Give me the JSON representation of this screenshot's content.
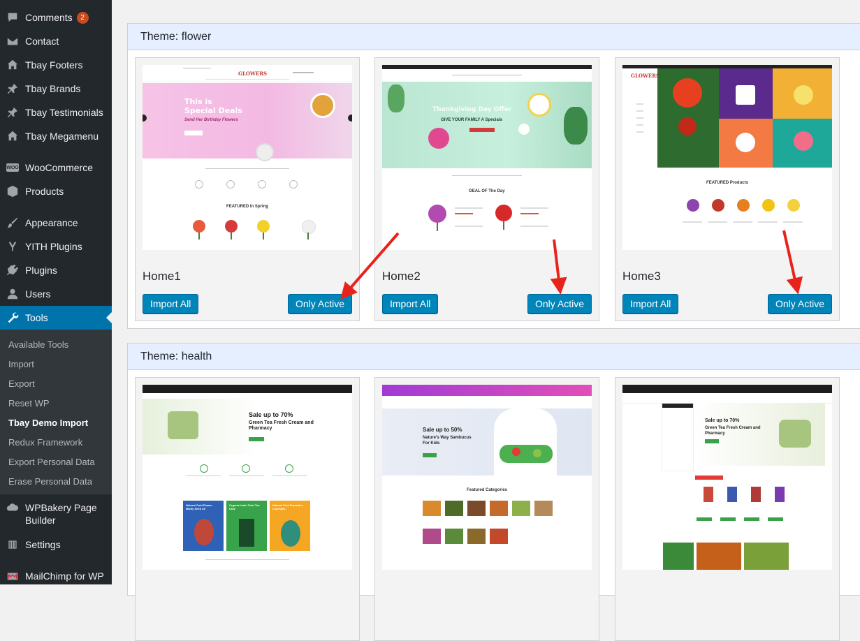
{
  "sidebar": {
    "items": [
      {
        "label": "Comments",
        "badge": "2",
        "icon": "comment-icon"
      },
      {
        "label": "Contact",
        "icon": "mail-icon"
      },
      {
        "label": "Tbay Footers",
        "icon": "home-icon"
      },
      {
        "label": "Tbay Brands",
        "icon": "pin-icon"
      },
      {
        "label": "Tbay Testimonials",
        "icon": "pin-icon"
      },
      {
        "label": "Tbay Megamenu",
        "icon": "home-icon"
      },
      {
        "label": "WooCommerce",
        "icon": "woo-icon"
      },
      {
        "label": "Products",
        "icon": "box-icon"
      },
      {
        "label": "Appearance",
        "icon": "brush-icon"
      },
      {
        "label": "YITH Plugins",
        "icon": "yith-icon"
      },
      {
        "label": "Plugins",
        "icon": "plug-icon"
      },
      {
        "label": "Users",
        "icon": "user-icon"
      },
      {
        "label": "Tools",
        "icon": "wrench-icon"
      },
      {
        "label": "WPBakery Page Builder",
        "icon": "cloud-icon"
      },
      {
        "label": "Settings",
        "icon": "sliders-icon"
      },
      {
        "label": "MailChimp for WP",
        "icon": "mailchimp-icon"
      }
    ],
    "tools_submenu": [
      "Available Tools",
      "Import",
      "Export",
      "Reset WP",
      "Tbay Demo Import",
      "Redux Framework",
      "Export Personal Data",
      "Erase Personal Data"
    ],
    "current_submenu": "Tbay Demo Import"
  },
  "themes": [
    {
      "title": "Theme: flower",
      "demos": [
        {
          "name": "Home1",
          "import_all": "Import All",
          "only_active": "Only Active",
          "preview": {
            "logo": "GLOWERS",
            "hero_line1": "This is",
            "hero_line2": "Special Deals",
            "hero_sub": "Send Her Birthday Flowers",
            "section": "FEATURED In Spring"
          }
        },
        {
          "name": "Home2",
          "import_all": "Import All",
          "only_active": "Only Active",
          "preview": {
            "hero_line1": "Thankgiving Day Offer",
            "hero_sub": "GIVE YOUR FAMILY A Specials",
            "section": "DEAL OF The Day"
          }
        },
        {
          "name": "Home3",
          "import_all": "Import All",
          "only_active": "Only Active",
          "preview": {
            "logo": "GLOWERS",
            "section": "FEATURED Products"
          }
        }
      ]
    },
    {
      "title": "Theme: health",
      "demos": [
        {
          "preview": {
            "hero_line1": "Sale up to 70%",
            "hero_line2": "Green Tea Fresh Cream and Pharmacy",
            "tiles": [
              "Natural Cold Flower Manly Seed oil",
              "Organic Indie Tulsi Tea Chai",
              "Natural Cold Remedies Lozenges"
            ]
          }
        },
        {
          "preview": {
            "hero_line1": "Sale up to 50%",
            "hero_line2": "Nature's Way Sambucus For Kids",
            "section": "Featured Categories"
          }
        },
        {
          "preview": {
            "hero_line1": "Sale up to 70%",
            "hero_line2": "Green Tea Fresh Cream and Pharmacy"
          }
        }
      ]
    }
  ],
  "colors": {
    "sidebar_bg": "#23282d",
    "active_menu": "#0073aa",
    "button_bg": "#0085ba",
    "theme_header_bg": "#e5efff",
    "annotation_arrow": "#e8231b"
  }
}
